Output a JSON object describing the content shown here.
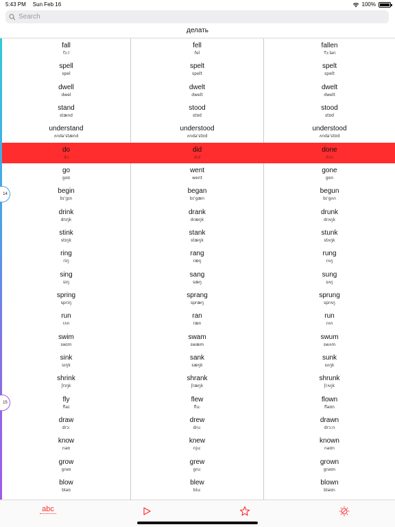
{
  "status_bar": {
    "time": "5:43 PM",
    "date": "Sun Feb 16",
    "battery": "100%",
    "battery_level": 1.0
  },
  "search": {
    "placeholder": "Search",
    "value": ""
  },
  "title": "делать",
  "markers": [
    "14",
    "15"
  ],
  "rows": [
    {
      "base": {
        "word": "fall",
        "ipa": "fɔːl"
      },
      "past": {
        "word": "fell",
        "ipa": "fel"
      },
      "participle": {
        "word": "fallen",
        "ipa": "ˈfɔːlən"
      }
    },
    {
      "base": {
        "word": "spell",
        "ipa": "spel"
      },
      "past": {
        "word": "spelt",
        "ipa": "spelt"
      },
      "participle": {
        "word": "spelt",
        "ipa": "spelt"
      }
    },
    {
      "base": {
        "word": "dwell",
        "ipa": "dwel"
      },
      "past": {
        "word": "dwelt",
        "ipa": "dwelt"
      },
      "participle": {
        "word": "dwelt",
        "ipa": "dwelt"
      }
    },
    {
      "base": {
        "word": "stand",
        "ipa": "stænd"
      },
      "past": {
        "word": "stood",
        "ipa": "stʊd"
      },
      "participle": {
        "word": "stood",
        "ipa": "stʊd"
      }
    },
    {
      "base": {
        "word": "understand",
        "ipa": "ʌndəˈstænd"
      },
      "past": {
        "word": "understood",
        "ipa": "ʌndəˈstʊd"
      },
      "participle": {
        "word": "understood",
        "ipa": "ʌndəˈstʊd"
      }
    },
    {
      "base": {
        "word": "do",
        "ipa": "du"
      },
      "past": {
        "word": "did",
        "ipa": "dɪd"
      },
      "participle": {
        "word": "done",
        "ipa": "dʌn"
      },
      "highlighted": true
    },
    {
      "base": {
        "word": "go",
        "ipa": "goʊ"
      },
      "past": {
        "word": "went",
        "ipa": "went"
      },
      "participle": {
        "word": "gone",
        "ipa": "gɒn"
      }
    },
    {
      "base": {
        "word": "begin",
        "ipa": "bɪˈgɪn"
      },
      "past": {
        "word": "began",
        "ipa": "bɪˈgæn"
      },
      "participle": {
        "word": "begun",
        "ipa": "bɪˈgʌn"
      }
    },
    {
      "base": {
        "word": "drink",
        "ipa": "drɪŋk"
      },
      "past": {
        "word": "drank",
        "ipa": "dræŋk"
      },
      "participle": {
        "word": "drunk",
        "ipa": "drʌŋk"
      }
    },
    {
      "base": {
        "word": "stink",
        "ipa": "stɪŋk"
      },
      "past": {
        "word": "stank",
        "ipa": "stæŋk"
      },
      "participle": {
        "word": "stunk",
        "ipa": "stʌŋk"
      }
    },
    {
      "base": {
        "word": "ring",
        "ipa": "rɪŋ"
      },
      "past": {
        "word": "rang",
        "ipa": "ræŋ"
      },
      "participle": {
        "word": "rung",
        "ipa": "rʌŋ"
      }
    },
    {
      "base": {
        "word": "sing",
        "ipa": "sɪŋ"
      },
      "past": {
        "word": "sang",
        "ipa": "sæŋ"
      },
      "participle": {
        "word": "sung",
        "ipa": "sʌŋ"
      }
    },
    {
      "base": {
        "word": "spring",
        "ipa": "sprɪŋ"
      },
      "past": {
        "word": "sprang",
        "ipa": "spræŋ"
      },
      "participle": {
        "word": "sprung",
        "ipa": "sprʌŋ"
      }
    },
    {
      "base": {
        "word": "run",
        "ipa": "rʌn"
      },
      "past": {
        "word": "ran",
        "ipa": "ræn"
      },
      "participle": {
        "word": "run",
        "ipa": "rʌn"
      }
    },
    {
      "base": {
        "word": "swim",
        "ipa": "swɪm"
      },
      "past": {
        "word": "swam",
        "ipa": "swæm"
      },
      "participle": {
        "word": "swum",
        "ipa": "swʌm"
      }
    },
    {
      "base": {
        "word": "sink",
        "ipa": "sɪŋk"
      },
      "past": {
        "word": "sank",
        "ipa": "sæŋk"
      },
      "participle": {
        "word": "sunk",
        "ipa": "sʌŋk"
      }
    },
    {
      "base": {
        "word": "shrink",
        "ipa": "ʃrɪŋk"
      },
      "past": {
        "word": "shrank",
        "ipa": "ʃræŋk"
      },
      "participle": {
        "word": "shrunk",
        "ipa": "ʃrʌŋk"
      }
    },
    {
      "base": {
        "word": "fly",
        "ipa": "flaɪ"
      },
      "past": {
        "word": "flew",
        "ipa": "fluː"
      },
      "participle": {
        "word": "flown",
        "ipa": "fləʊn"
      }
    },
    {
      "base": {
        "word": "draw",
        "ipa": "drɔː"
      },
      "past": {
        "word": "drew",
        "ipa": "druː"
      },
      "participle": {
        "word": "drawn",
        "ipa": "drɔːn"
      }
    },
    {
      "base": {
        "word": "know",
        "ipa": "nəʊ"
      },
      "past": {
        "word": "knew",
        "ipa": "njuː"
      },
      "participle": {
        "word": "known",
        "ipa": "nəʊn"
      }
    },
    {
      "base": {
        "word": "grow",
        "ipa": "grəʊ"
      },
      "past": {
        "word": "grew",
        "ipa": "gruː"
      },
      "participle": {
        "word": "grown",
        "ipa": "grəʊn"
      }
    },
    {
      "base": {
        "word": "blow",
        "ipa": "bləʊ"
      },
      "past": {
        "word": "blew",
        "ipa": "bluː"
      },
      "participle": {
        "word": "blown",
        "ipa": "bləʊn"
      }
    }
  ],
  "tabs": [
    {
      "name": "abc-tab",
      "label": "abc",
      "icon": "abc-icon",
      "active": true
    },
    {
      "name": "play-tab",
      "icon": "play-icon"
    },
    {
      "name": "favorites-tab",
      "icon": "star-icon"
    },
    {
      "name": "settings-tab",
      "icon": "settings-sun-icon"
    }
  ],
  "colors": {
    "accent": "#ff2d2d",
    "highlight_row": "#ff2d2d",
    "side_gradient_top": "#34c8d8",
    "side_gradient_bottom": "#a05ae8"
  }
}
